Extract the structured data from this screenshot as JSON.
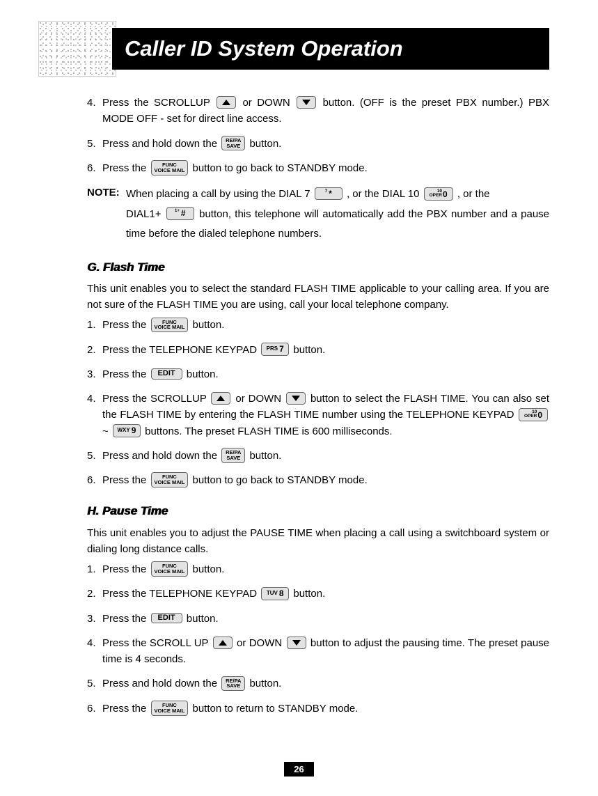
{
  "title": "Caller ID System Operation",
  "page_number": "26",
  "list_a": {
    "i4_a": "Press the SCROLLUP",
    "i4_b": "or DOWN",
    "i4_c": "button. (OFF is the preset PBX number.) PBX MODE OFF - set for direct line access.",
    "i5_a": "Press and hold down the",
    "i5_b": "button.",
    "i6_a": "Press the",
    "i6_b": "button to go back to STANDBY mode."
  },
  "note": {
    "label": "NOTE",
    "l1a": "When placing a call by using the DIAL 7",
    "l1b": ", or the DIAL 10",
    "l1c": ", or the",
    "l2a": "DIAL1+",
    "l2b": "button, this telephone will automatically add the PBX number and a pause time before the dialed telephone numbers."
  },
  "g": {
    "heading": "G. Flash Time",
    "intro": "This unit enables you to select the standard FLASH TIME applicable to your calling area. If you are not sure of the FLASH TIME you are using, call your local telephone company.",
    "i1_a": "Press the",
    "i1_b": "button.",
    "i2_a": "Press the TELEPHONE KEYPAD",
    "i2_b": "button.",
    "i3_a": "Press the",
    "i3_b": "button.",
    "i4_a": "Press the SCROLLUP",
    "i4_b": "or DOWN",
    "i4_c": "button to select the FLASH TIME. You can also set the FLASH TIME by entering the FLASH TIME number using the TELEPHONE KEYPAD",
    "i4_d": "~",
    "i4_e": "buttons. The preset FLASH TIME is 600 milliseconds.",
    "i5_a": "Press and hold down the",
    "i5_b": "button.",
    "i6_a": "Press the",
    "i6_b": "button to go back to STANDBY mode."
  },
  "h": {
    "heading": "H. Pause Time",
    "intro": "This unit enables you to adjust the PAUSE TIME when placing a call using a switchboard system or dialing long distance calls.",
    "i1_a": "Press the",
    "i1_b": "button.",
    "i2_a": "Press the TELEPHONE KEYPAD",
    "i2_b": "button.",
    "i3_a": "Press the",
    "i3_b": "button.",
    "i4_a": "Press the SCROLL UP",
    "i4_b": "or DOWN",
    "i4_c": "button to adjust the pausing time. The preset pause time is 4 seconds.",
    "i5_a": "Press and hold down the",
    "i5_b": "button.",
    "i6_a": "Press the",
    "i6_b": "button to return to STANDBY mode."
  },
  "buttons": {
    "func_l1": "FUNC",
    "func_l2": "VOICE MAIL",
    "save_l1": "RE/PA",
    "save_l2": "SAVE",
    "edit": "EDIT",
    "k7_sub": "PRS",
    "k7_big": "7",
    "k8_sub": "TUV",
    "k8_big": "8",
    "k9_sub": "WXY",
    "k9_big": "9",
    "k0_sup": "10",
    "k0_sub": "OPER",
    "k0_big": "0",
    "star_sup": "7",
    "star_big": "*",
    "hash_sup": "1+",
    "hash_big": "#"
  }
}
